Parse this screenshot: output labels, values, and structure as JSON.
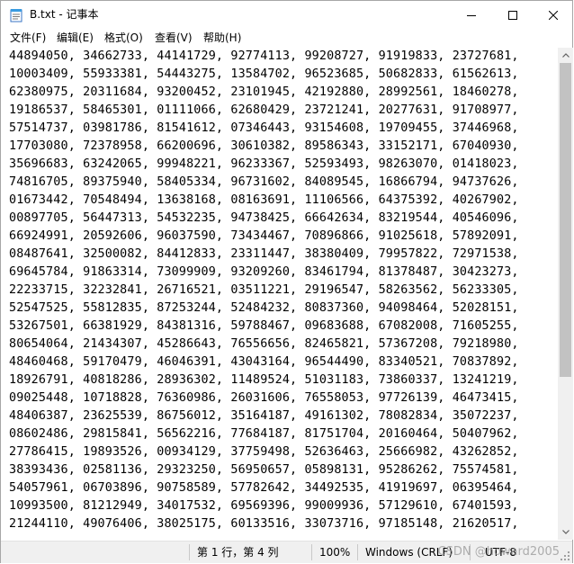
{
  "window": {
    "title": "B.txt - 记事本",
    "icon": "notepad-icon",
    "controls": [
      "minimize-icon",
      "maximize-icon",
      "close-icon"
    ]
  },
  "menu": {
    "file": "文件(F)",
    "edit": "编辑(E)",
    "format": "格式(O)",
    "view": "查看(V)",
    "help": "帮助(H)"
  },
  "editor": {
    "lines": [
      "44894050, 34662733, 44141729, 92774113, 99208727, 91919833, 23727681,",
      "10003409, 55933381, 54443275, 13584702, 96523685, 50682833, 61562613,",
      "62380975, 20311684, 93200452, 23101945, 42192880, 28992561, 18460278,",
      "19186537, 58465301, 01111066, 62680429, 23721241, 20277631, 91708977,",
      "57514737, 03981786, 81541612, 07346443, 93154608, 19709455, 37446968,",
      "17703080, 72378958, 66200696, 30610382, 89586343, 33152171, 67040930,",
      "35696683, 63242065, 99948221, 96233367, 52593493, 98263070, 01418023,",
      "74816705, 89375940, 58405334, 96731602, 84089545, 16866794, 94737626,",
      "01673442, 70548494, 13638168, 08163691, 11106566, 64375392, 40267902,",
      "00897705, 56447313, 54532235, 94738425, 66642634, 83219544, 40546096,",
      "66924991, 20592606, 96037590, 73434467, 70896866, 91025618, 57892091,",
      "08487641, 32500082, 84412833, 23311447, 38380409, 79957822, 72971538,",
      "69645784, 91863314, 73099909, 93209260, 83461794, 81378487, 30423273,",
      "22233715, 32232841, 26716521, 03511221, 29196547, 58263562, 56233305,",
      "52547525, 55812835, 87253244, 52484232, 80837360, 94098464, 52028151,",
      "53267501, 66381929, 84381316, 59788467, 09683688, 67082008, 71605255,",
      "80654064, 21434307, 45286643, 76556656, 82465821, 57367208, 79218980,",
      "48460468, 59170479, 46046391, 43043164, 96544490, 83340521, 70837892,",
      "18926791, 40818286, 28936302, 11489524, 51031183, 73860337, 13241219,",
      "09025448, 10718828, 76360986, 26031606, 76558053, 97726139, 46473415,",
      "48406387, 23625539, 86756012, 35164187, 49161302, 78082834, 35072237,",
      "08602486, 29815841, 56562216, 77684187, 81751704, 20160464, 50407962,",
      "27786415, 19893526, 00934129, 37759498, 52636463, 25666982, 43262852,",
      "38393436, 02581136, 29323250, 56950657, 05898131, 95286262, 75574581,",
      "54057961, 06703896, 90758589, 57782642, 34492535, 41919697, 06395464,",
      "10993500, 81212949, 34017532, 69569396, 99009936, 57129610, 67401593,",
      "21244110, 49076406, 38025175, 60133516, 33073716, 97185148, 21620517,"
    ]
  },
  "status": {
    "position": "第 1 行，第 4 列",
    "zoom": "100%",
    "line_ending": "Windows (CRLF)",
    "encoding": "UTF-8",
    "watermark": "CSDN @howard2005"
  },
  "scrollbar": {
    "thumb_fraction_top": 0.0,
    "thumb_fraction_height": 0.68
  }
}
